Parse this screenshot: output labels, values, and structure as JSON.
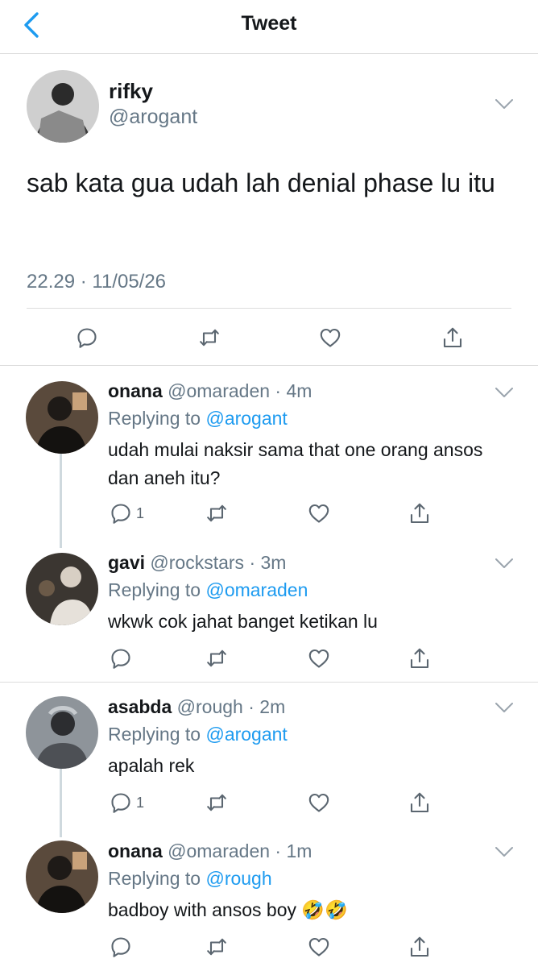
{
  "nav": {
    "title": "Tweet"
  },
  "tweet": {
    "name": "rifky",
    "handle": "@arogant",
    "text": "sab kata gua udah lah denial phase lu itu",
    "timestamp": "22.29 · 11/05/26"
  },
  "replies": [
    {
      "name": "onana",
      "handle": "@omaraden",
      "time": "4m",
      "replying_prefix": "Replying to",
      "replying_to": "@arogant",
      "text": "udah mulai naksir sama that one orang ansos dan aneh itu?",
      "reply_count": "1"
    },
    {
      "name": "gavi",
      "handle": "@rockstars",
      "time": "3m",
      "replying_prefix": "Replying to",
      "replying_to": "@omaraden",
      "text": "wkwk cok jahat banget ketikan lu",
      "reply_count": ""
    },
    {
      "name": "asabda",
      "handle": "@rough",
      "time": "2m",
      "replying_prefix": "Replying to",
      "replying_to": "@arogant",
      "text": "apalah rek",
      "reply_count": "1"
    },
    {
      "name": "onana",
      "handle": "@omaraden",
      "time": "1m",
      "replying_prefix": "Replying to",
      "replying_to": "@rough",
      "text": "badboy with ansos boy",
      "emojis": "🤣🤣",
      "reply_count": ""
    }
  ],
  "separator": " · ",
  "icons": [
    "back-chevron-icon",
    "chevron-down-icon",
    "reply-icon",
    "retweet-icon",
    "like-icon",
    "share-icon"
  ],
  "colors": {
    "link": "#1d9bf0",
    "secondary": "#657786",
    "divider": "#dcdcdc",
    "thread": "#cfd9de"
  }
}
